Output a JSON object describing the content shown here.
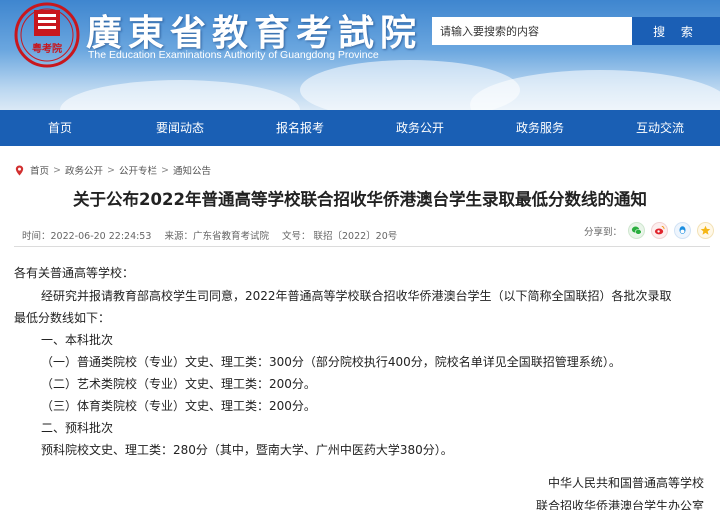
{
  "header": {
    "emblem_text": "粤考院",
    "title": "廣東省教育考試院",
    "subtitle": "The Education Examinations Authority of Guangdong Province",
    "search_placeholder": "请输入要搜索的内容",
    "search_button": "搜 索",
    "brand_color": "#1a5fb4",
    "emblem_color": "#c8171e"
  },
  "nav": {
    "items": [
      {
        "label": "首页"
      },
      {
        "label": "要闻动态"
      },
      {
        "label": "报名报考"
      },
      {
        "label": "政务公开"
      },
      {
        "label": "政务服务"
      },
      {
        "label": "互动交流"
      }
    ]
  },
  "breadcrumb": {
    "items": [
      "首页",
      "政务公开",
      "公开专栏",
      "通知公告"
    ],
    "separator": ">"
  },
  "article": {
    "title": "关于公布2022年普通高等学校联合招收华侨港澳台学生录取最低分数线的通知",
    "time": "时间：2022-06-20 22:24:53",
    "source": "来源：广东省教育考试院",
    "doc_no": "文号：  联招〔2022〕20号",
    "share_label": "分享到：",
    "share_icons": [
      "wechat-icon",
      "weibo-icon",
      "qq-icon",
      "qzone-icon"
    ],
    "body": {
      "greeting": "各有关普通高等学校：",
      "intro_1": "经研究并报请教育部高校学生司同意，2022年普通高等学校联合招收华侨港澳台学生（以下简称全国联招）各批次录取",
      "intro_2": "最低分数线如下：",
      "section_1": "一、本科批次",
      "item_1": "（一）普通类院校（专业）文史、理工类：300分（部分院校执行400分，院校名单详见全国联招管理系统）。",
      "item_2": "（二）艺术类院校（专业）文史、理工类：200分。",
      "item_3": "（三）体育类院校（专业）文史、理工类：200分。",
      "section_2": "二、预科批次",
      "item_4": "预科院校文史、理工类：280分（其中，暨南大学、广州中医药大学380分）。"
    },
    "signature_1": "中华人民共和国普通高等学校",
    "signature_2": "联合招收华侨港澳台学生办公室"
  }
}
